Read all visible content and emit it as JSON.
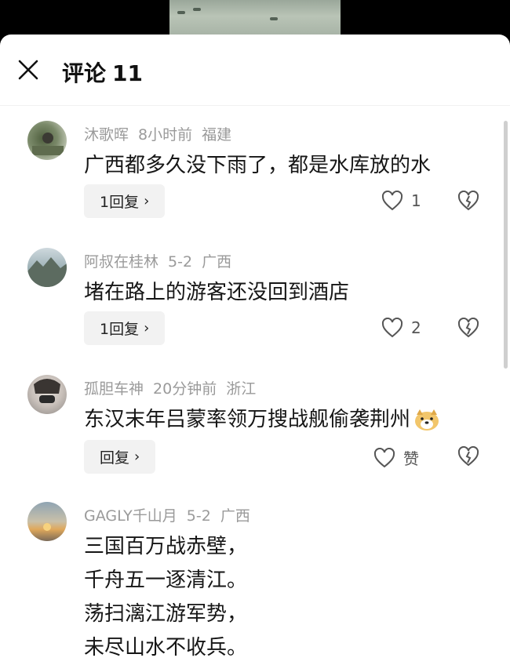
{
  "header": {
    "title": "评论",
    "count": "11"
  },
  "comments": [
    {
      "user": "沐歌晖",
      "time": "8小时前",
      "location": "福建",
      "text": "广西都多久没下雨了，都是水库放的水",
      "reply_label": "1回复",
      "like_label": "1"
    },
    {
      "user": "阿叔在桂林",
      "time": "5-2",
      "location": "广西",
      "text": "堵在路上的游客还没回到酒店",
      "reply_label": "1回复",
      "like_label": "2"
    },
    {
      "user": "孤胆车神",
      "time": "20分钟前",
      "location": "浙江",
      "text": "东汉末年吕蒙率领万搜战舰偷袭荆州",
      "reply_label": "回复",
      "like_label": "赞"
    },
    {
      "user": "GAGLY千山月",
      "time": "5-2",
      "location": "广西",
      "lines": [
        "三国百万战赤壁，",
        "千舟五一逐清江。",
        "荡扫漓江游军势，",
        "未尽山水不收兵。"
      ]
    }
  ],
  "icons": {
    "close": "close-icon",
    "like": "heart-outline-icon",
    "dislike": "broken-heart-icon",
    "chevron": "chevron-right-icon",
    "emoji": "doge-emoji-icon"
  },
  "colors": {
    "meta_text": "#9a9a9a",
    "body_text": "#161616",
    "reply_bg": "#f2f2f2"
  }
}
